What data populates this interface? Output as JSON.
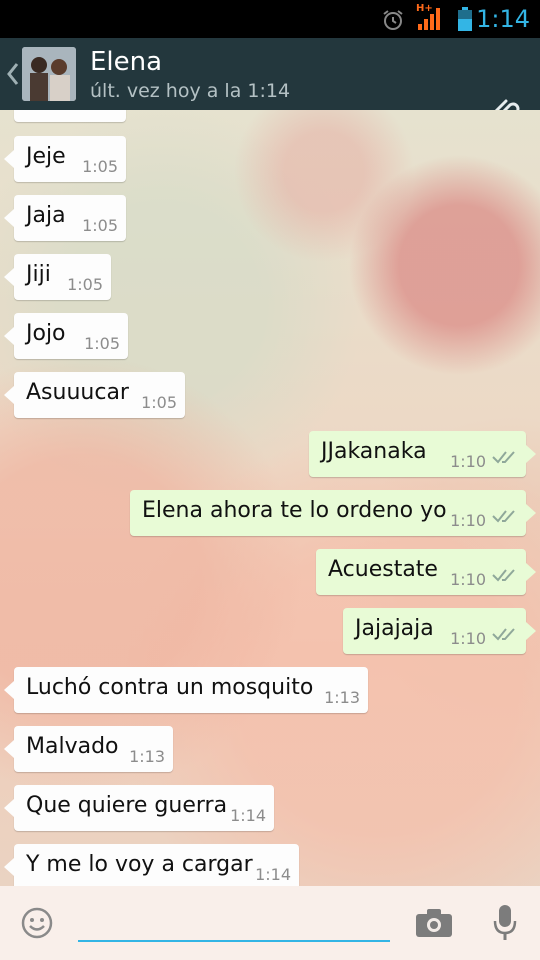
{
  "status_bar": {
    "time": "1:14",
    "network": "H+",
    "icons": [
      "alarm-icon",
      "signal-icon",
      "battery-icon"
    ]
  },
  "header": {
    "contact_name": "Elena",
    "last_seen": "últ. vez hoy a la 1:14",
    "icons": [
      "back-icon",
      "avatar",
      "attach-icon"
    ]
  },
  "messages": [
    {
      "dir": "in",
      "text": "Jeje",
      "time": "1:05"
    },
    {
      "dir": "in",
      "text": "Jaja",
      "time": "1:05"
    },
    {
      "dir": "in",
      "text": "Jiji",
      "time": "1:05"
    },
    {
      "dir": "in",
      "text": "Jojo",
      "time": "1:05"
    },
    {
      "dir": "in",
      "text": "Asuuucar",
      "time": "1:05"
    },
    {
      "dir": "out",
      "text": "JJakanaka",
      "time": "1:10",
      "status": "read"
    },
    {
      "dir": "out",
      "text": "Elena ahora te lo ordeno yo",
      "time": "1:10",
      "status": "read"
    },
    {
      "dir": "out",
      "text": "Acuestate",
      "time": "1:10",
      "status": "read"
    },
    {
      "dir": "out",
      "text": "Jajajaja",
      "time": "1:10",
      "status": "read"
    },
    {
      "dir": "in",
      "text": "Luchó contra un mosquito",
      "time": "1:13"
    },
    {
      "dir": "in",
      "text": "Malvado",
      "time": "1:13"
    },
    {
      "dir": "in",
      "text": "Que quiere guerra",
      "time": "1:14"
    },
    {
      "dir": "in",
      "text": "Y me lo voy a cargar",
      "time": "1:14"
    }
  ],
  "input_bar": {
    "placeholder": "",
    "icons": [
      "emoji-icon",
      "camera-icon",
      "mic-icon"
    ]
  },
  "colors": {
    "accent": "#33b5e5",
    "header_bg": "#23373d",
    "incoming_bubble": "#fdfdfd",
    "outgoing_bubble": "#e8fbd6",
    "read_ticks": "#8fa89a"
  }
}
